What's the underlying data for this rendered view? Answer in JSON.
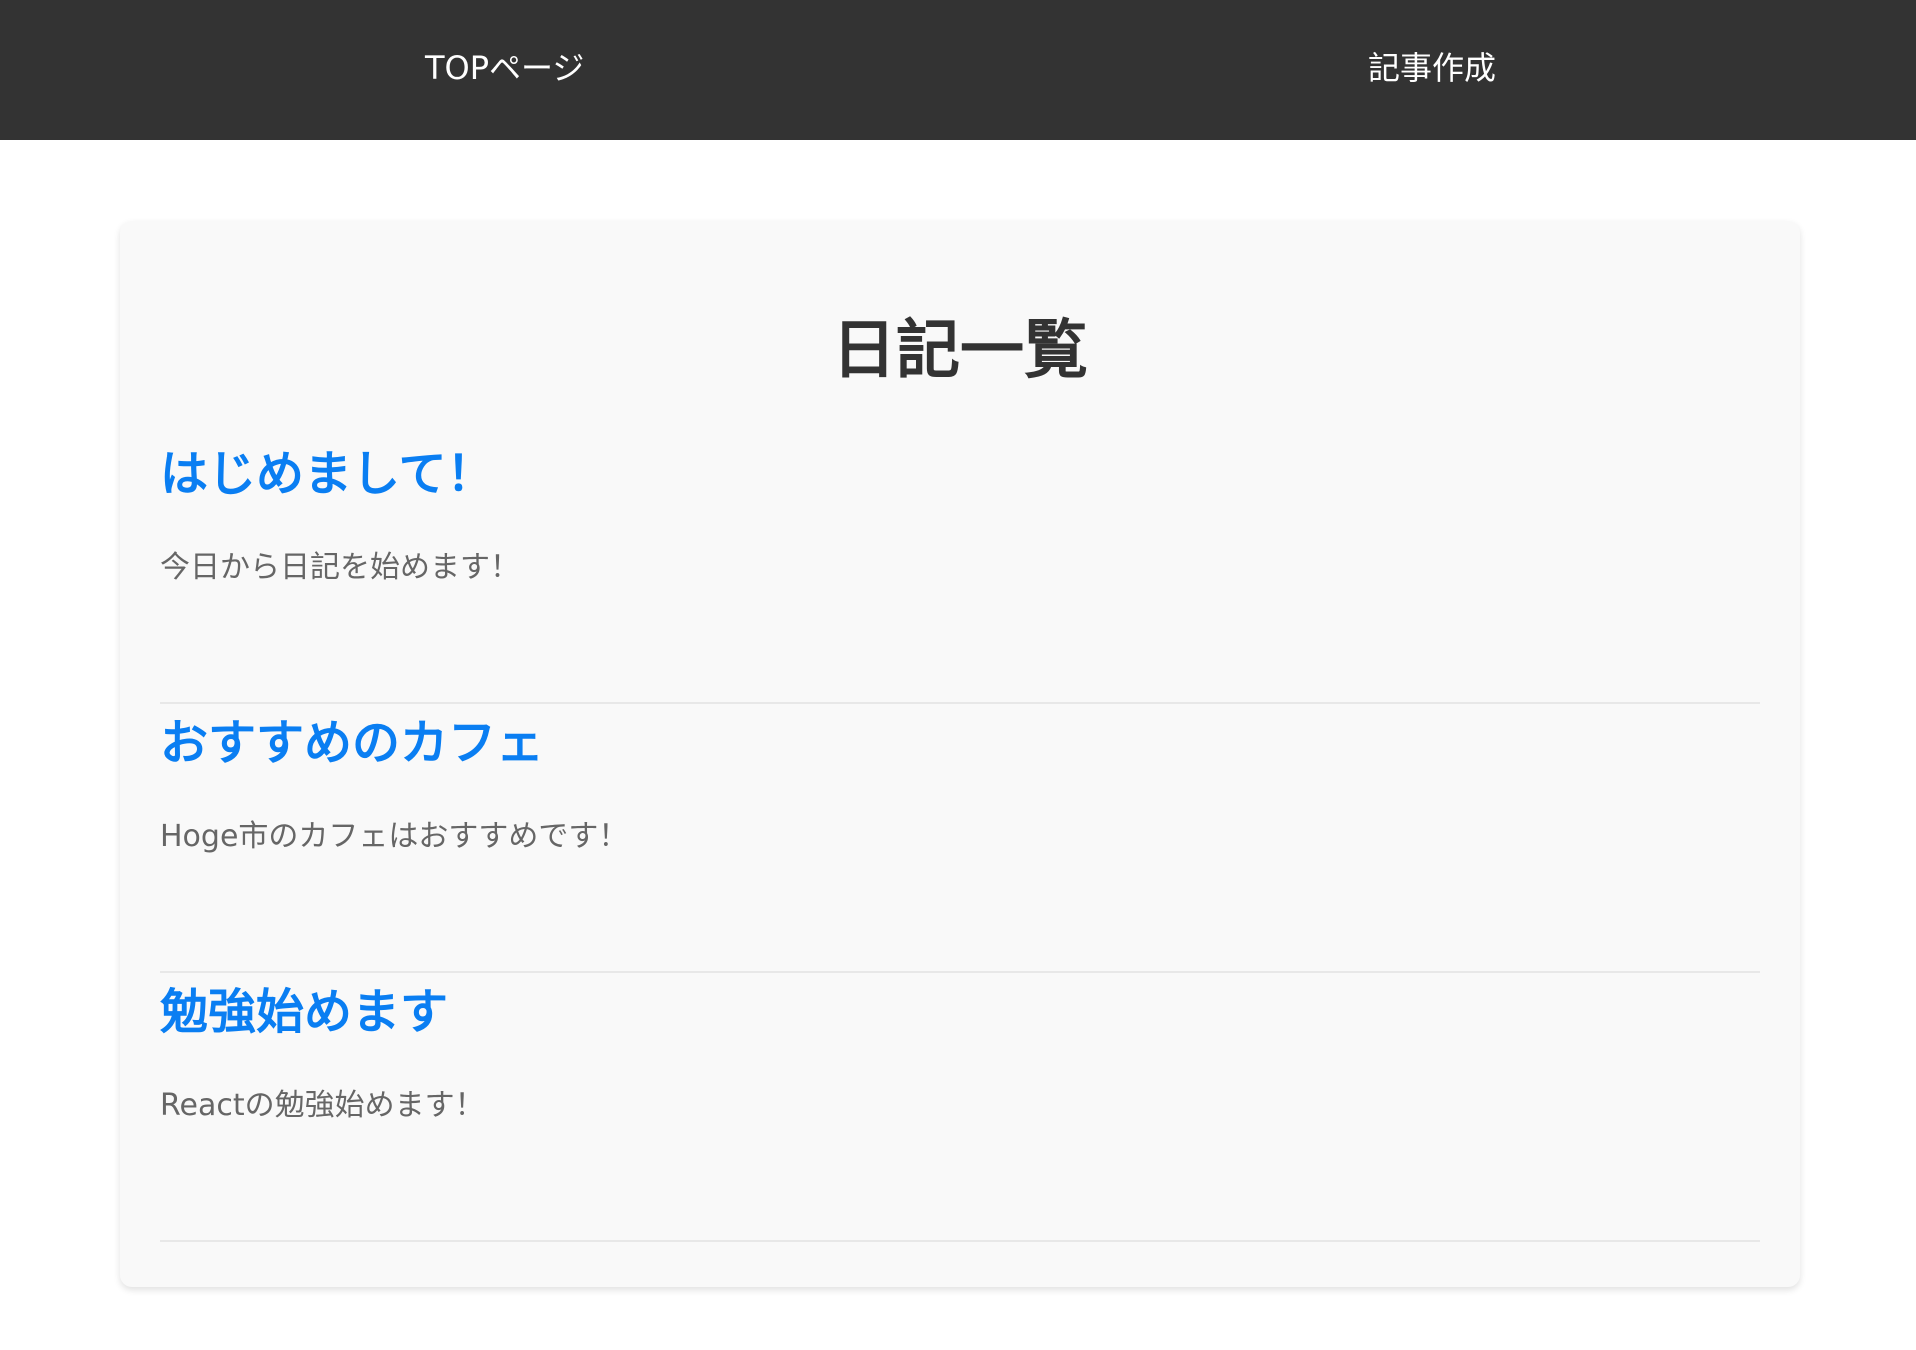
{
  "nav": {
    "top_label": "TOPページ",
    "create_label": "記事作成"
  },
  "main": {
    "title": "日記一覧",
    "diaries": [
      {
        "title": "はじめまして！",
        "body": "今日から日記を始めます！"
      },
      {
        "title": "おすすめのカフェ",
        "body": "Hoge市のカフェはおすすめです！"
      },
      {
        "title": "勉強始めます",
        "body": "Reactの勉強始めます！"
      }
    ]
  },
  "colors": {
    "nav_bg": "#333333",
    "link_blue": "#0a7ef2",
    "body_text": "#666666",
    "card_bg": "#f9f9f9"
  }
}
